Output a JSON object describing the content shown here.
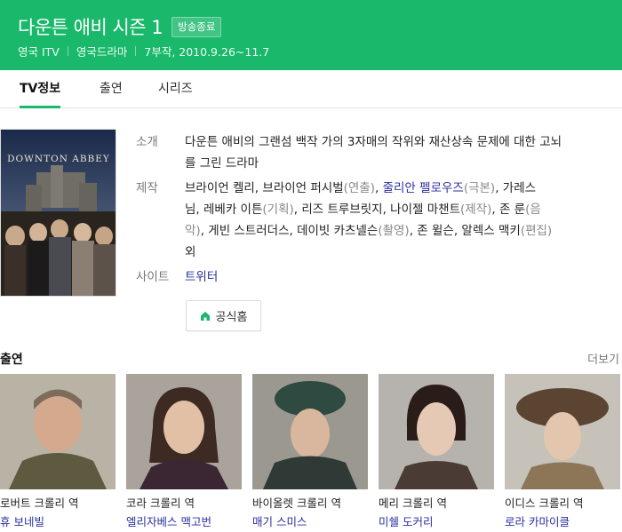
{
  "header": {
    "title": "다운튼 애비 시즌 1",
    "badge": "방송종료",
    "channel": "영국 ITV",
    "genre": "영국드라마",
    "schedule": "7부작, 2010.9.26~11.7"
  },
  "tabs": [
    {
      "label": "TV정보",
      "active": true
    },
    {
      "label": "출연",
      "active": false
    },
    {
      "label": "시리즈",
      "active": false
    }
  ],
  "poster": {
    "title_text": "DOWNTON ABBEY"
  },
  "info": {
    "intro_label": "소개",
    "intro_text_1": "다운튼 애비의 그랜섬 백작 가의 3자매의 작위와 재산상속 문제에 대한 고뇌",
    "intro_text_2": "를 그린 드라마",
    "production_label": "제작",
    "production_line1_a": "브라이언 켈리, 브라이언 퍼시벌",
    "production_line1_b": "(연출)",
    "production_line1_c": ", ",
    "production_line1_link": "줄리안 펠로우즈",
    "production_line1_d": "(극본)",
    "production_line1_e": ", 가레스",
    "production_line2_a": "님, 레베카 이튼",
    "production_line2_b": "(기획)",
    "production_line2_c": ", 리즈 트루브릿지, 나이젤 마챈트",
    "production_line2_d": "(제작)",
    "production_line2_e": ", 존 룬",
    "production_line2_f": "(음",
    "production_line3_a": "악)",
    "production_line3_b": ", 게빈 스트러더스, 데이빗 카츠넬슨",
    "production_line3_c": "(촬영)",
    "production_line3_d": ", 존 윌슨, 알렉스 맥키",
    "production_line3_e": "(편집)",
    "production_line4": "외",
    "site_label": "사이트",
    "site_link": "트위터",
    "homepage_button": "공식홈"
  },
  "cast_section": {
    "title": "출연",
    "more": "더보기",
    "members": [
      {
        "role": "로버트 크롤리 역",
        "actor": "휴 보네빌"
      },
      {
        "role": "코라 크롤리 역",
        "actor": "엘리자베스 맥고번"
      },
      {
        "role": "바이올렛 크롤리 역",
        "actor": "매기 스미스"
      },
      {
        "role": "메리 크롤리 역",
        "actor": "미쉘 도커리"
      },
      {
        "role": "이디스 크롤리 역",
        "actor": "로라 카마이클"
      }
    ]
  },
  "colors": {
    "brand_green": "#19b86b",
    "link_blue": "#2a2f9e"
  }
}
